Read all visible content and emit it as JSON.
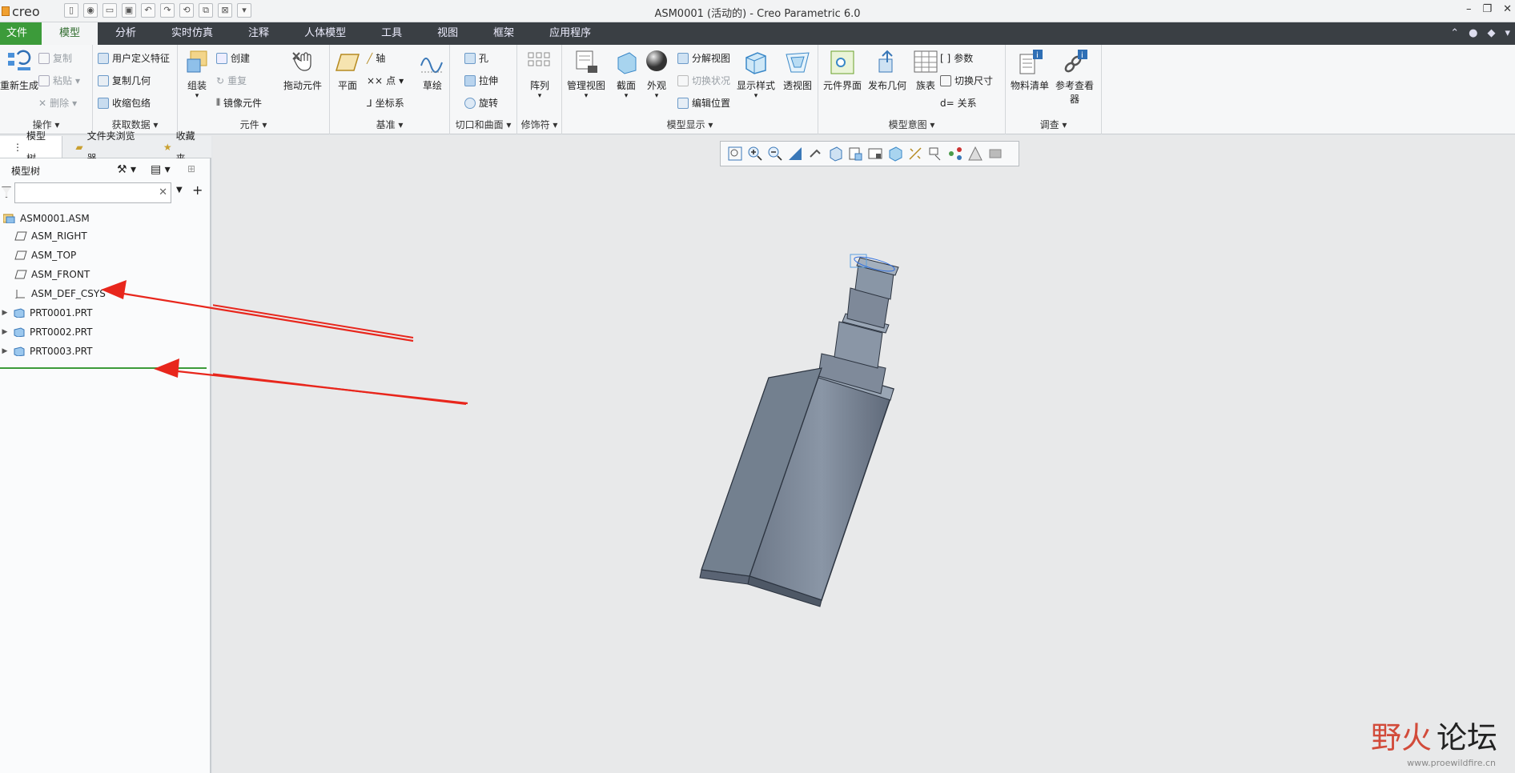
{
  "app": {
    "logo": "creo",
    "window_title": "ASM0001 (活动的) - Creo Parametric 6.0"
  },
  "menus": [
    {
      "label": "文件"
    },
    {
      "label": "模型"
    },
    {
      "label": "分析"
    },
    {
      "label": "实时仿真"
    },
    {
      "label": "注释"
    },
    {
      "label": "人体模型"
    },
    {
      "label": "工具"
    },
    {
      "label": "视图"
    },
    {
      "label": "框架"
    },
    {
      "label": "应用程序"
    }
  ],
  "ribbon": {
    "ops": {
      "name": "操作",
      "regen": "重新生成",
      "copy": "复制",
      "paste": "粘贴",
      "delete": "删除"
    },
    "getdata": {
      "name": "获取数据",
      "udf": "用户定义特征",
      "copygeom": "复制几何",
      "shrink": "收缩包络"
    },
    "component": {
      "name": "元件",
      "assemble": "组装",
      "create": "创建",
      "repeat": "重复",
      "mirror": "镜像元件",
      "drag": "拖动元件"
    },
    "datum": {
      "name": "基准",
      "plane": "平面",
      "axis": "轴",
      "point": "点",
      "csys": "坐标系",
      "sketch": "草绘"
    },
    "cut": {
      "name": "切口和曲面",
      "hole": "孔",
      "extrude": "拉伸",
      "revolve": "旋转"
    },
    "modifier": {
      "name": "修饰符",
      "pattern": "阵列"
    },
    "display": {
      "name": "模型显示",
      "manage": "管理视图",
      "section": "截面",
      "appearance": "外观",
      "explode": "分解视图",
      "toggle": "切换状况",
      "editpos": "编辑位置",
      "style": "显示样式",
      "perspective": "透视图"
    },
    "intent": {
      "name": "模型意图",
      "interface": "元件界面",
      "pubgeom": "发布几何",
      "family": "族表",
      "params": "参数",
      "switchdim": "切换尺寸",
      "relations": "关系"
    },
    "investigate": {
      "name": "调查",
      "bom": "物料清单",
      "refviewer_1": "参考查看",
      "refviewer_2": "器"
    }
  },
  "panel_tabs": [
    {
      "label": "模型树"
    },
    {
      "label": "文件夹浏览器"
    },
    {
      "label": "收藏夹"
    }
  ],
  "tree": {
    "header": "模型树",
    "items": [
      {
        "label": "ASM0001.ASM"
      },
      {
        "label": "ASM_RIGHT"
      },
      {
        "label": "ASM_TOP"
      },
      {
        "label": "ASM_FRONT"
      },
      {
        "label": "ASM_DEF_CSYS"
      },
      {
        "label": "PRT0001.PRT"
      },
      {
        "label": "PRT0002.PRT"
      },
      {
        "label": "PRT0003.PRT"
      }
    ]
  },
  "watermark": {
    "a": "野火",
    "b": "论坛",
    "sub": "www.proewildfire.cn"
  },
  "colors": {
    "accent": "#3c9b3a",
    "menubar": "#3a3f44",
    "arrow": "#e8261c",
    "model": "#7f8c9c"
  }
}
